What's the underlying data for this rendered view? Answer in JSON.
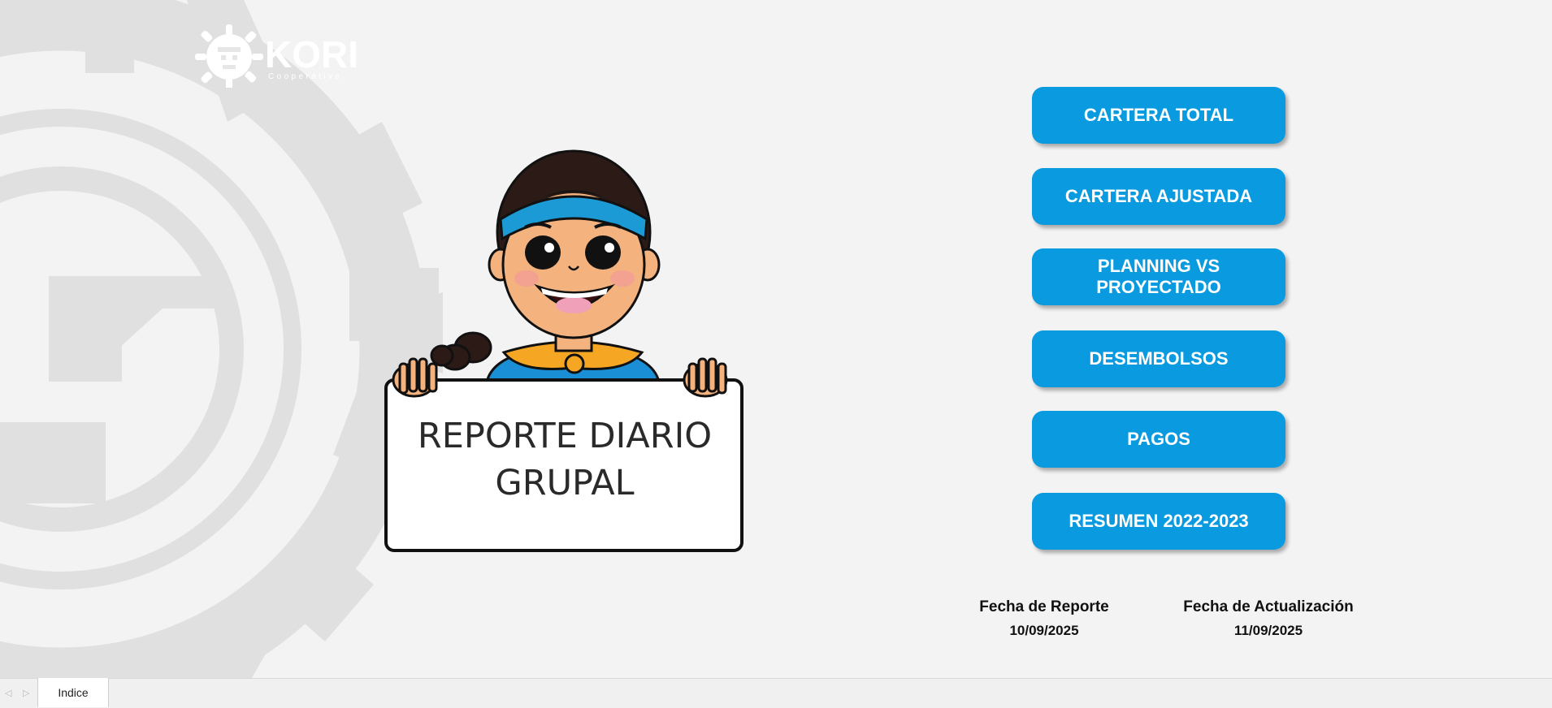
{
  "logo": {
    "brand": "KORI",
    "subtitle": "Cooperative"
  },
  "sign": {
    "line1": "REPORTE DIARIO",
    "line2": "GRUPAL"
  },
  "nav_buttons": [
    {
      "label": "CARTERA TOTAL"
    },
    {
      "label": "CARTERA AJUSTADA"
    },
    {
      "label": "PLANNING VS PROYECTADO"
    },
    {
      "label": "DESEMBOLSOS"
    },
    {
      "label": "PAGOS"
    },
    {
      "label": "RESUMEN 2022-2023"
    }
  ],
  "dates": {
    "report_label": "Fecha de Reporte",
    "report_value": "10/09/2025",
    "update_label": "Fecha de Actualización",
    "update_value": "11/09/2025"
  },
  "sheet_tabs": [
    {
      "label": "Indice",
      "active": true
    }
  ],
  "colors": {
    "button_bg": "#0a9ae0",
    "background": "#f3f3f3",
    "watermark": "#e2e2e2"
  },
  "icons": {
    "prev_sheet": "triangle-left",
    "next_sheet": "triangle-right"
  }
}
